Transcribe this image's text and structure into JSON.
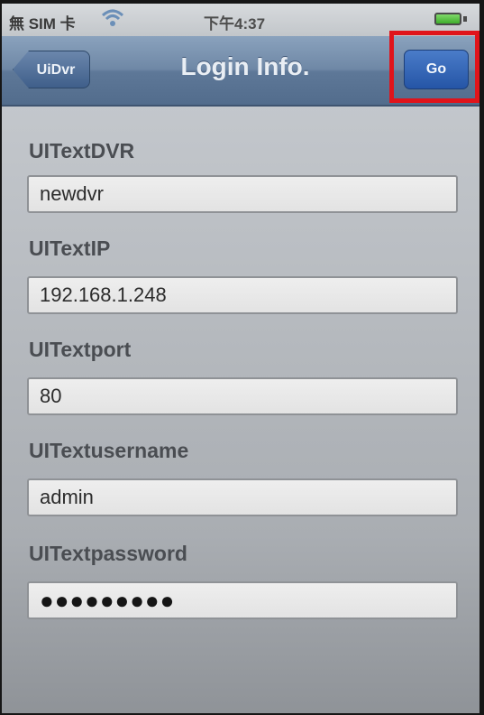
{
  "status_bar": {
    "carrier": "無 SIM 卡",
    "time": "下午4:37",
    "icons": [
      "wifi-icon",
      "battery-icon"
    ]
  },
  "nav_bar": {
    "back_label": "UiDvr",
    "title": "Login Info.",
    "go_label": "Go"
  },
  "form": {
    "fields": [
      {
        "label": "UITextDVR",
        "value": "newdvr"
      },
      {
        "label": "UITextIP",
        "value": "192.168.1.248"
      },
      {
        "label": "UITextport",
        "value": "80"
      },
      {
        "label": "UITextusername",
        "value": "admin"
      },
      {
        "label": "UITextpassword",
        "value": "●●●●●●●●●"
      }
    ]
  },
  "colors": {
    "nav_bar": "#6f88a6",
    "go_button": "#2555a6",
    "highlight": "#e0141b",
    "background": "#b8bcc1"
  }
}
